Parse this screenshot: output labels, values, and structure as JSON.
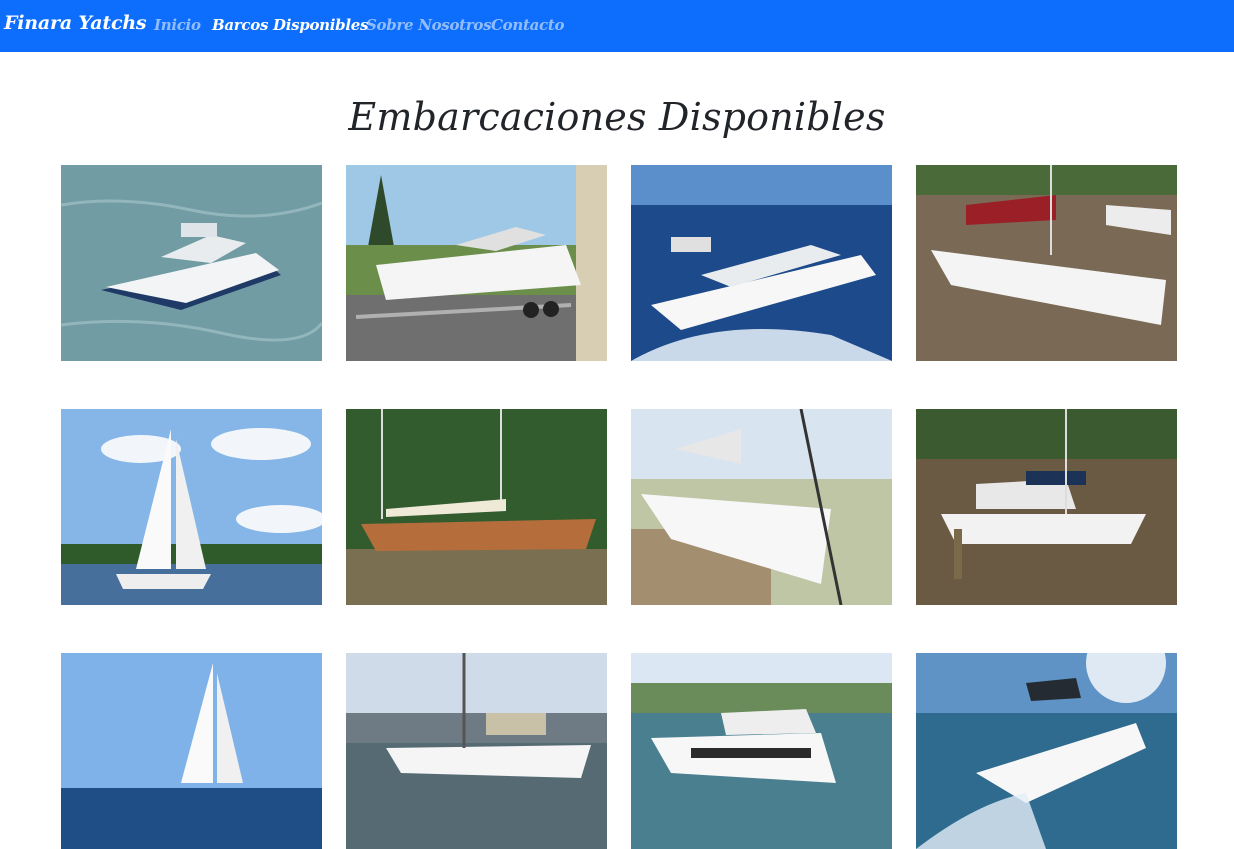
{
  "navbar": {
    "brand": "Finara Yatchs",
    "links": [
      {
        "label": "Inicio",
        "active": false
      },
      {
        "label": "Barcos Disponibles",
        "active": true
      },
      {
        "label": "Sobre Nosotros",
        "active": false
      },
      {
        "label": "Contacto",
        "active": false
      }
    ]
  },
  "page": {
    "title": "Embarcaciones Disponibles"
  },
  "colors": {
    "navbar_bg": "#0d6efd",
    "link_active": "#ffffff",
    "link_inactive": "rgba(255,255,255,0.55)",
    "title_text": "#212529"
  }
}
